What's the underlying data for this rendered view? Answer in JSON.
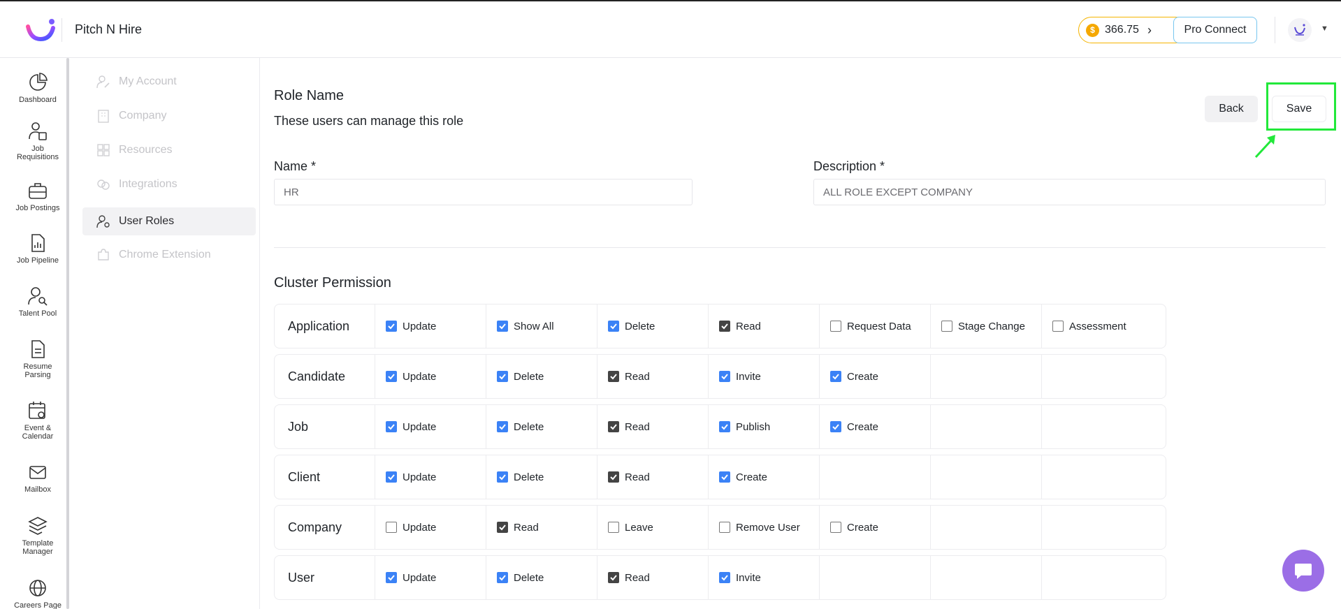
{
  "header": {
    "app_title": "Pitch N Hire",
    "credits": "366.75",
    "coin_symbol": "$",
    "pro_connect_label": "Pro Connect"
  },
  "icon_nav": [
    {
      "label": "Dashboard",
      "icon": "pie-chart-icon"
    },
    {
      "label": "Job Requisitions",
      "icon": "user-doc-icon"
    },
    {
      "label": "Job Postings",
      "icon": "briefcase-icon"
    },
    {
      "label": "Job Pipeline",
      "icon": "chart-doc-icon"
    },
    {
      "label": "Talent Pool",
      "icon": "user-search-icon"
    },
    {
      "label": "Resume Parsing",
      "icon": "document-icon"
    },
    {
      "label": "Event & Calendar",
      "icon": "calendar-icon"
    },
    {
      "label": "Mailbox",
      "icon": "mail-icon"
    },
    {
      "label": "Template Manager",
      "icon": "layers-icon"
    },
    {
      "label": "Careers Page",
      "icon": "globe-icon"
    }
  ],
  "sub_menu": [
    {
      "label": "My Account",
      "icon": "user-edit-icon",
      "active": false
    },
    {
      "label": "Company",
      "icon": "building-icon",
      "active": false
    },
    {
      "label": "Resources",
      "icon": "grid-icon",
      "active": false
    },
    {
      "label": "Integrations",
      "icon": "link-icon",
      "active": false
    },
    {
      "label": "User Roles",
      "icon": "user-gear-icon",
      "active": true
    },
    {
      "label": "Chrome Extension",
      "icon": "puzzle-icon",
      "active": false
    }
  ],
  "main": {
    "title": "Role Name",
    "subtitle": "These users can manage this role",
    "back_label": "Back",
    "save_label": "Save",
    "name_label": "Name *",
    "name_value": "HR",
    "description_label": "Description *",
    "description_value": "ALL ROLE EXCEPT COMPANY",
    "cluster_title": "Cluster Permission"
  },
  "permissions": [
    {
      "name": "Application",
      "items": [
        {
          "label": "Update",
          "state": "blue"
        },
        {
          "label": "Show All",
          "state": "blue"
        },
        {
          "label": "Delete",
          "state": "blue"
        },
        {
          "label": "Read",
          "state": "dark"
        },
        {
          "label": "Request Data",
          "state": "off"
        },
        {
          "label": "Stage Change",
          "state": "off"
        },
        {
          "label": "Assessment",
          "state": "off"
        }
      ]
    },
    {
      "name": "Candidate",
      "items": [
        {
          "label": "Update",
          "state": "blue"
        },
        {
          "label": "Delete",
          "state": "blue"
        },
        {
          "label": "Read",
          "state": "dark"
        },
        {
          "label": "Invite",
          "state": "blue"
        },
        {
          "label": "Create",
          "state": "blue"
        }
      ]
    },
    {
      "name": "Job",
      "items": [
        {
          "label": "Update",
          "state": "blue"
        },
        {
          "label": "Delete",
          "state": "blue"
        },
        {
          "label": "Read",
          "state": "dark"
        },
        {
          "label": "Publish",
          "state": "blue"
        },
        {
          "label": "Create",
          "state": "blue"
        }
      ]
    },
    {
      "name": "Client",
      "items": [
        {
          "label": "Update",
          "state": "blue"
        },
        {
          "label": "Delete",
          "state": "blue"
        },
        {
          "label": "Read",
          "state": "dark"
        },
        {
          "label": "Create",
          "state": "blue"
        }
      ]
    },
    {
      "name": "Company",
      "items": [
        {
          "label": "Update",
          "state": "off"
        },
        {
          "label": "Read",
          "state": "dark"
        },
        {
          "label": "Leave",
          "state": "off"
        },
        {
          "label": "Remove User",
          "state": "off"
        },
        {
          "label": "Create",
          "state": "off"
        }
      ]
    },
    {
      "name": "User",
      "items": [
        {
          "label": "Update",
          "state": "blue"
        },
        {
          "label": "Delete",
          "state": "blue"
        },
        {
          "label": "Read",
          "state": "dark"
        },
        {
          "label": "Invite",
          "state": "blue"
        }
      ]
    }
  ],
  "colors": {
    "accent_blue": "#3b82f6",
    "highlight_green": "#22e83a",
    "chat_purple": "#9b6ee6",
    "coin_gold": "#f5a800"
  }
}
